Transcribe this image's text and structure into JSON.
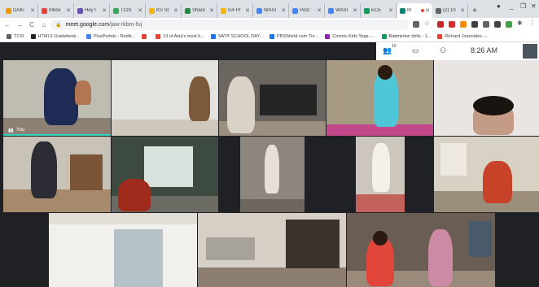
{
  "tabs": [
    {
      "label": "DAKi",
      "color": "#f29900"
    },
    {
      "label": "Inbox",
      "color": "#ea4335"
    },
    {
      "label": "Hey l",
      "color": "#6b4fbb"
    },
    {
      "label": "TCIS",
      "color": "#34a853"
    },
    {
      "label": "KS St",
      "color": "#f4b400"
    },
    {
      "label": "Share",
      "color": "#1e8e3e"
    },
    {
      "label": "G4 Pr",
      "color": "#f4b400"
    },
    {
      "label": "WASI",
      "color": "#4285f4"
    },
    {
      "label": "Post",
      "color": "#4285f4"
    },
    {
      "label": "WASI",
      "color": "#4285f4"
    },
    {
      "label": "ECE",
      "color": "#0f9d58"
    },
    {
      "label": "M",
      "color": "#00897b"
    },
    {
      "label": "(2) 10",
      "color": "#5f6368"
    }
  ],
  "new_tab_label": "+",
  "window_controls": {
    "profile": "●",
    "minimize": "_",
    "maximize": "❐",
    "close": "✕"
  },
  "nav": {
    "back": "←",
    "forward": "→",
    "reload": "C",
    "home": "⌂"
  },
  "url": {
    "host": "meet.google.com",
    "path": "/jaw-rkbm-fuj"
  },
  "bookmarks": [
    {
      "label": "TCIS",
      "color": "#5f6368"
    },
    {
      "label": "HTML5 Gradebook...",
      "color": "#202124"
    },
    {
      "label": "PlusPortals - Redik...",
      "color": "#4285f4"
    },
    {
      "label": "",
      "color": "#ea4335"
    },
    {
      "label": "13 of Asia's most b...",
      "color": "#ea4335"
    },
    {
      "label": "SAT® SCHOOL DAY...",
      "color": "#1a73e8"
    },
    {
      "label": "PBSWorld.com Tre...",
      "color": "#1a73e8"
    },
    {
      "label": "Cosmic Kids Yoga -...",
      "color": "#8e24aa"
    },
    {
      "label": "Badminton drills - 1...",
      "color": "#0f9d58"
    },
    {
      "label": "Richard Joannides -...",
      "color": "#ea4335"
    }
  ],
  "meet": {
    "participant_count": "10",
    "time": "8:26 AM",
    "you_label": "You"
  },
  "colors": {
    "accent": "#34d3c0",
    "meet_bg": "#202124"
  }
}
